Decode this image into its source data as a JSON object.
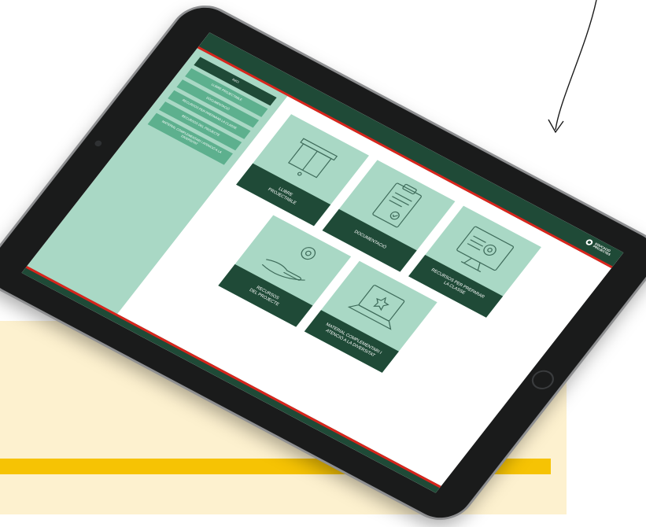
{
  "colors": {
    "header_green": "#1f4a37",
    "accent_red": "#d9251c",
    "tile_mint": "#a9d8c5",
    "menu_green": "#5db08e",
    "beige_panel": "#fdf1cf",
    "yellow_bar": "#f6c304"
  },
  "header": {
    "logo_icon": "ring-logo-icon",
    "logo_text": "EDUCACIÓ\nPROJECTES"
  },
  "sidebar": {
    "items": [
      {
        "label": "INICI",
        "active": true
      },
      {
        "label": "LLIBRE PROJECTABLE",
        "active": false
      },
      {
        "label": "DOCUMENTACIÓ",
        "active": false
      },
      {
        "label": "RECURSOS PER PREPARAR LA CLASSE",
        "active": false
      },
      {
        "label": "RECURSOS DEL PROJECTE",
        "active": false
      },
      {
        "label": "MATERIAL COMPLEMENTARI I ATENCIÓ A LA DIVERSITAT",
        "active": false
      }
    ]
  },
  "tiles": [
    {
      "label": "LLIBRE\nPROJECTABLE",
      "icon": "projector-screen-icon"
    },
    {
      "label": "DOCUMENTACIÓ",
      "icon": "clipboard-document-icon"
    },
    {
      "label": "RECURSOS PER PREPARAR\nLA CLASSE",
      "icon": "monitor-gear-icon"
    },
    {
      "label": "RECURSOS\nDEL PROJECTE",
      "icon": "hand-gear-icon"
    },
    {
      "label": "MATERIAL COMPLEMENTARI I\nATENCIÓ A LA DIVERSITAT",
      "icon": "laptop-star-icon"
    }
  ]
}
